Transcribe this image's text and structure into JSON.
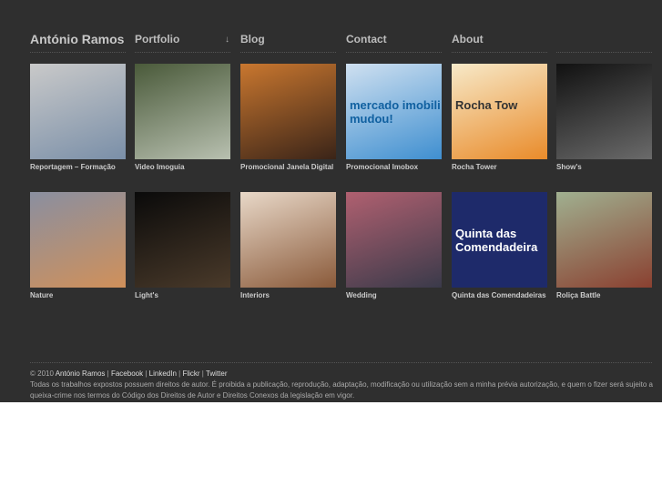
{
  "header": {
    "brand": "António Ramos",
    "nav": [
      "Portfolio",
      "Blog",
      "Contact",
      "About"
    ],
    "portfolio_arrow": "↓"
  },
  "items": [
    {
      "caption": "Reportagem – Formação",
      "colors": [
        "#c9c9c9",
        "#7a8fa8"
      ]
    },
    {
      "caption": "Video Imoguia",
      "colors": [
        "#4a5a3a",
        "#b8c0b0"
      ]
    },
    {
      "caption": "Promocional Janela Digital",
      "colors": [
        "#c9772f",
        "#3a2418"
      ]
    },
    {
      "caption": "Promocional Imobox",
      "colors": [
        "#cfe0f0",
        "#3f8fd0"
      ],
      "text": "mercado imobili mudou!"
    },
    {
      "caption": "Rocha Tower",
      "colors": [
        "#f7e9c8",
        "#e98b2a"
      ],
      "text": "Rocha Tow"
    },
    {
      "caption": "Show's",
      "colors": [
        "#111111",
        "#6a6a6a"
      ]
    },
    {
      "caption": "Nature",
      "colors": [
        "#8a8fa0",
        "#d0905a"
      ]
    },
    {
      "caption": "Light's",
      "colors": [
        "#0a0a0a",
        "#4a3a2a"
      ]
    },
    {
      "caption": "Interiors",
      "colors": [
        "#e8d8c8",
        "#8a5a3a"
      ]
    },
    {
      "caption": "Wedding",
      "colors": [
        "#b06070",
        "#3a3a4a"
      ]
    },
    {
      "caption": "Quinta das Comendadeiras",
      "colors": [
        "#1e2a6a",
        "#1e2a6a"
      ],
      "text": "Quinta das Comendadeira"
    },
    {
      "caption": "Roliça Battle",
      "colors": [
        "#a0b090",
        "#8a4030"
      ]
    }
  ],
  "footer": {
    "copyright": "© 2010",
    "name": "António Ramos",
    "links": [
      "Facebook",
      "LinkedIn",
      "Flickr",
      "Twitter"
    ],
    "sep": "|",
    "line2": "Todas os trabalhos expostos possuem direitos de autor. É proibida a publicação, reprodução, adaptação, modificação ou utilização sem a minha prévia autorização, e quem o fizer será sujeito a",
    "line3": "queixa-crime nos termos do Código dos Direitos de Autor e Direitos Conexos da legislação em vigor."
  }
}
